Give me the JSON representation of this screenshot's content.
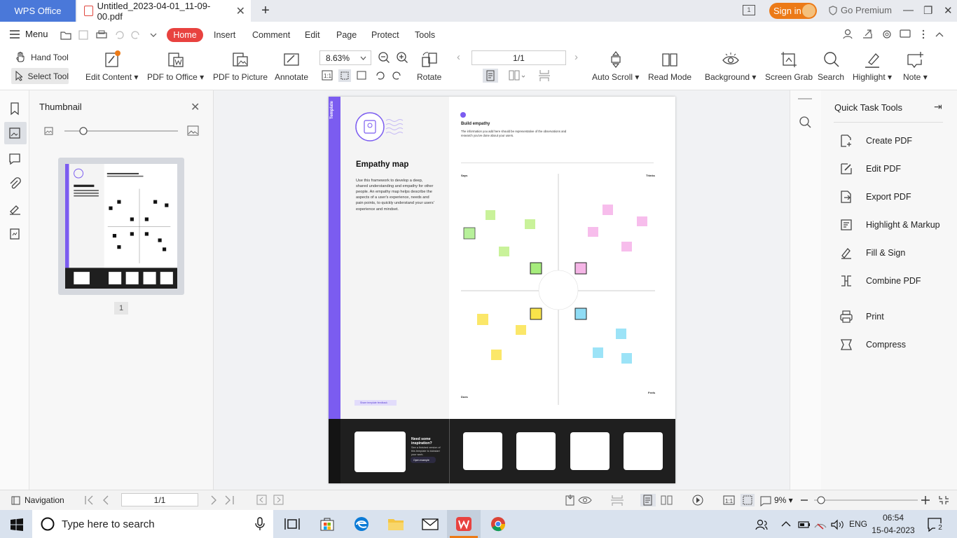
{
  "titlebar": {
    "app_tab": "WPS Office",
    "doc_tab": "Untitled_2023-04-01_11-09-00.pdf",
    "sign_in": "Sign in",
    "go_premium": "Go Premium"
  },
  "menubar": {
    "menu": "Menu",
    "tabs": [
      "Home",
      "Insert",
      "Comment",
      "Edit",
      "Page",
      "Protect",
      "Tools"
    ]
  },
  "toolbar": {
    "hand_tool": "Hand Tool",
    "select_tool": "Select Tool",
    "edit_content": "Edit Content",
    "pdf_to_office": "PDF to Office",
    "pdf_to_picture": "PDF to Picture",
    "annotate": "Annotate",
    "zoom": "8.63%",
    "rotate": "Rotate",
    "page": "1/1",
    "auto_scroll": "Auto Scroll",
    "read_mode": "Read Mode",
    "background": "Background",
    "screen_grab": "Screen Grab",
    "search": "Search",
    "highlight": "Highlight",
    "note": "Note"
  },
  "thumbnail": {
    "title": "Thumbnail",
    "page_number": "1"
  },
  "document": {
    "side_tag": "Template",
    "title": "Empathy map",
    "intro": "Use this framework to develop a deep, shared understanding and empathy for other people. An empathy map helps describe the aspects of a user's experience, needs and pain points, to quickly understand your users' experience and mindset.",
    "feedback": "Share template feedback",
    "build_title": "Build empathy",
    "build_text": "The information you add here should be representative of the observations and research you've done about your users.",
    "q_says": "Says",
    "q_thinks": "Thinks",
    "q_does": "Does",
    "q_feels": "Feels",
    "footer_title": "Need some inspiration?",
    "footer_text": "See a finished version of this template to kickstart your work.",
    "footer_button": "Open example"
  },
  "quick_tools": {
    "title": "Quick Task Tools",
    "items": [
      "Create PDF",
      "Edit PDF",
      "Export PDF",
      "Highlight & Markup",
      "Fill & Sign",
      "Combine PDF",
      "Print",
      "Compress"
    ]
  },
  "statusbar": {
    "navigation": "Navigation",
    "page": "1/1",
    "zoom": "9%"
  },
  "taskbar": {
    "search_placeholder": "Type here to search",
    "language": "ENG",
    "time": "06:54",
    "date": "15-04-2023",
    "notifications": "2"
  }
}
